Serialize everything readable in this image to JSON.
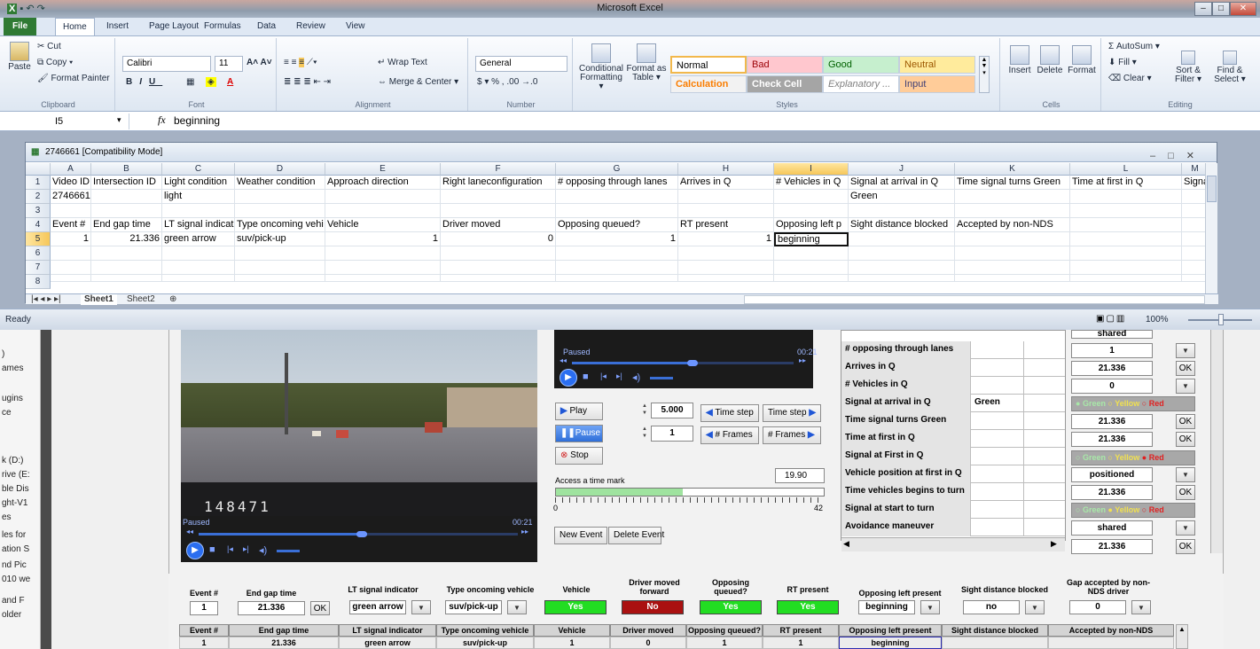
{
  "excel": {
    "window_title": "Microsoft Excel",
    "tabs": [
      "File",
      "Home",
      "Insert",
      "Page Layout",
      "Formulas",
      "Data",
      "Review",
      "View"
    ],
    "ribbon": {
      "clipboard": {
        "label": "Clipboard",
        "paste": "Paste",
        "cut": "Cut",
        "copy": "Copy ▾",
        "format_painter": "Format Painter"
      },
      "font": {
        "label": "Font",
        "name": "Calibri",
        "size": "11"
      },
      "alignment": {
        "label": "Alignment",
        "wrap": "Wrap Text",
        "merge": "Merge & Center ▾"
      },
      "number": {
        "label": "Number",
        "format": "General",
        "symbols": "$ ▾ %  ,   .00 →.0"
      },
      "styles": {
        "label": "Styles",
        "conditional": "Conditional Formatting ▾",
        "format_table": "Format as Table ▾",
        "normal": "Normal",
        "bad": "Bad",
        "good": "Good",
        "neutral": "Neutral",
        "calculation": "Calculation",
        "check_cell": "Check Cell",
        "explanatory": "Explanatory ...",
        "input": "Input"
      },
      "cells": {
        "label": "Cells",
        "insert": "Insert",
        "delete": "Delete",
        "format": "Format"
      },
      "editing": {
        "label": "Editing",
        "autosum": "Σ AutoSum ▾",
        "fill": "Fill ▾",
        "clear": "Clear ▾",
        "sort": "Sort & Filter ▾",
        "find": "Find & Select ▾"
      }
    },
    "formula_bar": {
      "name_box": "I5",
      "fx": "fx",
      "value": "beginning"
    },
    "document": {
      "title": "2746661  [Compatibility Mode]",
      "columns": [
        "A",
        "B",
        "C",
        "D",
        "E",
        "F",
        "G",
        "H",
        "I",
        "J",
        "K",
        "L",
        "M"
      ],
      "rows": [
        "1",
        "2",
        "3",
        "4",
        "5",
        "6",
        "7",
        "8"
      ],
      "row1": [
        "Video ID",
        "Intersection ID",
        "Light condition",
        "Weather condition",
        "Approach direction",
        "Right laneconfiguration",
        "# opposing through lanes",
        "Arrives in Q",
        "# Vehicles in Q",
        "Signal at arrival in Q",
        "Time signal turns Green",
        "Time at first in Q",
        "Signa"
      ],
      "row2": [
        "2746661",
        "",
        "light",
        "",
        "",
        "",
        "",
        "",
        "",
        "Green",
        "",
        "",
        ""
      ],
      "row4": [
        "Event #",
        "End gap time",
        "LT signal indicat",
        "Type oncoming vehi",
        "Vehicle",
        "Driver moved",
        "Opposing queued?",
        "RT present",
        "Opposing left p",
        "Sight distance blocked",
        "Accepted by non-NDS",
        "",
        ""
      ],
      "row5": [
        "1",
        "21.336",
        "green arrow",
        "suv/pick-up",
        "1",
        "0",
        "1",
        "1",
        "beginning",
        "",
        "",
        "",
        ""
      ],
      "sheet_tabs": [
        "Sheet1",
        "Sheet2"
      ]
    },
    "status": {
      "ready": "Ready",
      "zoom": "100%"
    }
  },
  "app": {
    "left_strip": [
      ")",
      "ames",
      "ugins",
      "ce",
      "k (D:)",
      "rive (E:",
      "ble Dis",
      "ght-V1",
      "es",
      "les for",
      "ation S",
      "nd Pic",
      "010 we",
      " and F",
      "older"
    ],
    "video1": {
      "counter": "148471",
      "status": "Paused",
      "time": "00:21"
    },
    "video2": {
      "status": "Paused",
      "time": "00:21"
    },
    "controls": {
      "play": "Play",
      "pause": "Pause",
      "stop": "Stop",
      "step_value": "5.000",
      "frames_value": "1",
      "time_step_back": "Time step",
      "time_step_fwd": "Time step",
      "frames_back": "# Frames",
      "frames_fwd": "# Frames",
      "time_mark_label": "Access a time mark",
      "time_mark_value": "19.90",
      "time_mark_min": "0",
      "time_mark_max": "42",
      "time_mark_fraction": 0.474,
      "new_event": "New Event",
      "delete_event": "Delete Event"
    },
    "properties": [
      {
        "name": "# opposing through lanes",
        "value": ""
      },
      {
        "name": "Arrives in Q",
        "value": ""
      },
      {
        "name": "# Vehicles in Q",
        "value": ""
      },
      {
        "name": "Signal at arrival in Q",
        "value": "Green"
      },
      {
        "name": "Time signal turns Green",
        "value": ""
      },
      {
        "name": "Time at first in Q",
        "value": ""
      },
      {
        "name": "Signal at First in Q",
        "value": ""
      },
      {
        "name": "Vehicle position at first in Q",
        "value": ""
      },
      {
        "name": "Time vehicles begins to turn",
        "value": ""
      },
      {
        "name": "Signal at start to turn",
        "value": ""
      },
      {
        "name": "Avoidance maneuver",
        "value": ""
      }
    ],
    "right_column": {
      "top_partial": "shared",
      "lanes": "1",
      "arrives": "21.336",
      "vehicles": "0",
      "turns_green": "21.336",
      "first_in_q": "21.336",
      "position": "positioned",
      "begins_turn": "21.336",
      "avoidance": "shared",
      "last": "21.336",
      "ok": "OK",
      "radio": {
        "green": "Green",
        "yellow": "Yellow",
        "red": "Red"
      }
    },
    "event_form": {
      "labels": [
        "Event #",
        "End gap time",
        "LT signal indicator",
        "Type oncoming vehicle",
        "Vehicle",
        "Driver moved forward",
        "Opposing queued?",
        "RT present",
        "Opposing left present",
        "Sight distance blocked",
        "Gap accepted by non-NDS driver"
      ],
      "event": "1",
      "end_gap": "21.336",
      "ok": "OK",
      "lt_signal": "green arrow",
      "type_vehicle": "suv/pick-up",
      "vehicle": "Yes",
      "driver_moved": "No",
      "opposing_queued": "Yes",
      "rt_present": "Yes",
      "opposing_left": "beginning",
      "sight_distance": "no",
      "gap_accepted": "0"
    },
    "event_table": {
      "headers": [
        "Event #",
        "End gap time",
        "LT signal indicator",
        "Type oncoming vehicle",
        "Vehicle",
        "Driver moved",
        "Opposing queued?",
        "RT present",
        "Opposing left present",
        "Sight distance blocked",
        "Accepted by non-NDS"
      ],
      "row": [
        "1",
        "21.336",
        "green arrow",
        "suv/pick-up",
        "1",
        "0",
        "1",
        "1",
        "beginning",
        "",
        ""
      ]
    }
  }
}
